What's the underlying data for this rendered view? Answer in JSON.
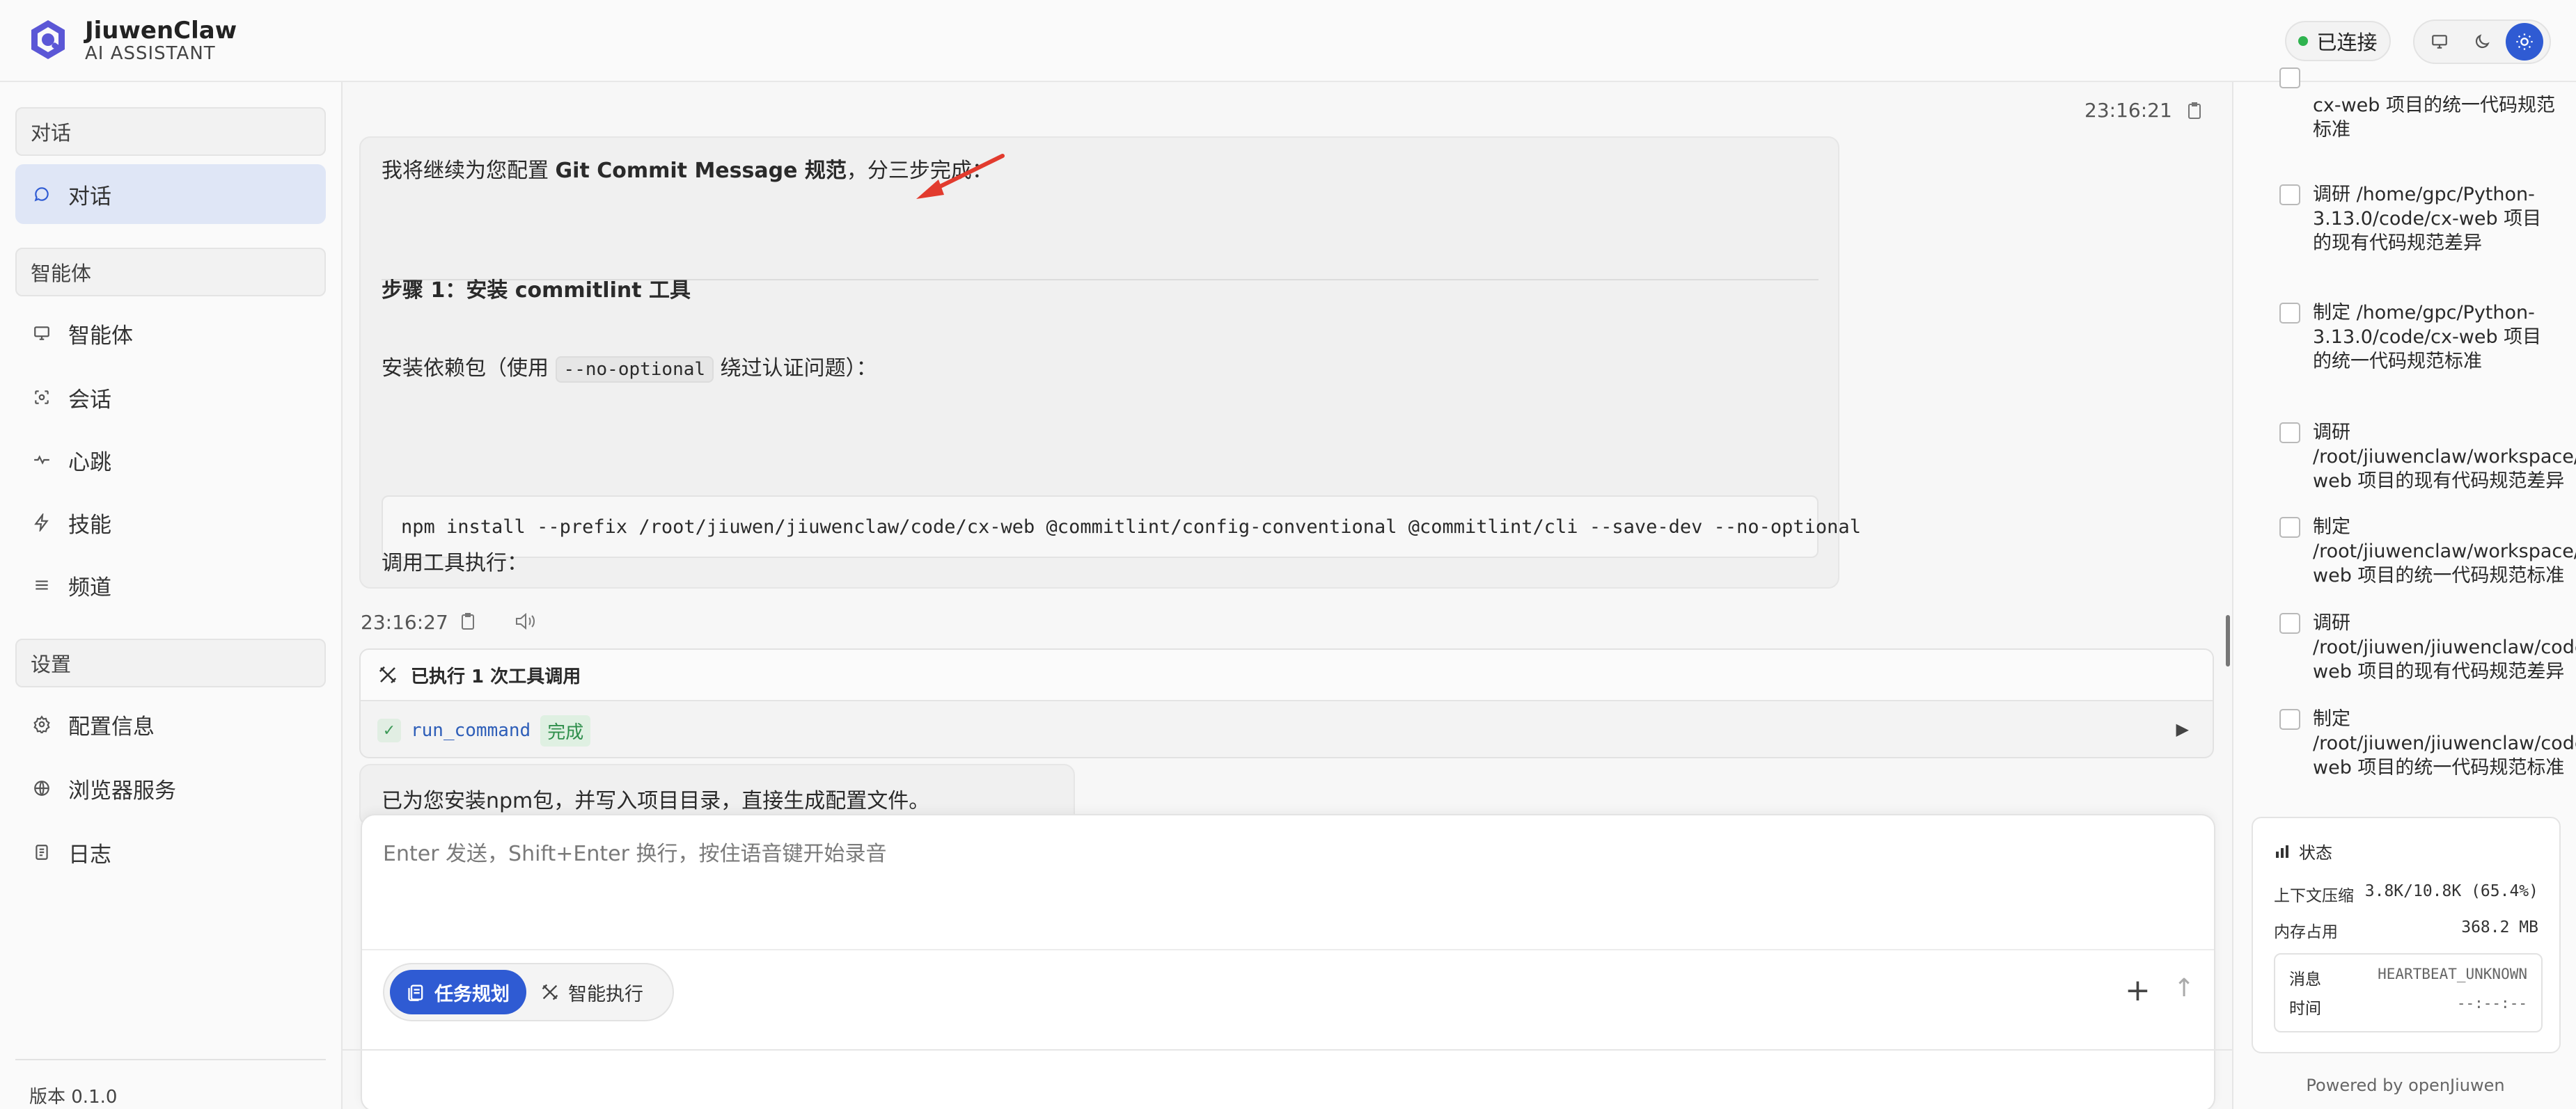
{
  "header": {
    "brand_name": "JiuwenClaw",
    "brand_sub": "AI ASSISTANT",
    "connection_status": "已连接",
    "connection_color": "#2fb34f",
    "theme_buttons": [
      "monitor-icon",
      "moon-icon",
      "sun-icon"
    ],
    "active_theme": "sun-icon",
    "accent": "#2f5bd3"
  },
  "sidebar": {
    "sections": [
      {
        "title": "对话",
        "items": [
          {
            "label": "对话",
            "icon": "chat-bubble-icon",
            "active": true
          }
        ]
      },
      {
        "title": "智能体",
        "items": [
          {
            "label": "智能体",
            "icon": "monitor-icon"
          },
          {
            "label": "会话",
            "icon": "scan-icon"
          },
          {
            "label": "心跳",
            "icon": "pulse-icon"
          },
          {
            "label": "技能",
            "icon": "lightning-icon"
          },
          {
            "label": "频道",
            "icon": "menu-icon"
          }
        ]
      },
      {
        "title": "设置",
        "items": [
          {
            "label": "配置信息",
            "icon": "gear-icon"
          },
          {
            "label": "浏览器服务",
            "icon": "globe-icon"
          },
          {
            "label": "日志",
            "icon": "document-icon"
          }
        ]
      }
    ],
    "version": "版本 0.1.0"
  },
  "chat": {
    "msg1_time": "23:16:21",
    "intro_prefix": "我将继续为您配置 ",
    "intro_bold": "Git Commit Message 规范",
    "intro_suffix": "，分三步完成：",
    "step1_title": "步骤 1：安装 commitlint 工具",
    "install_prefix": "安装依赖包（使用 ",
    "install_code": "--no-optional",
    "install_suffix": " 绕过认证问题）：",
    "code_block": "npm install --prefix /root/jiuwen/jiuwenclaw/code/cx-web @commitlint/config-conventional @commitlint/cli --save-dev --no-optional",
    "tool_call_text": "调用工具执行：",
    "msg2_time": "23:16:27",
    "tool_header": "已执行 1 次工具调用",
    "tool_command": "run_command",
    "tool_status": "完成",
    "msg3_text": "已为您安装npm包，并写入项目目录，直接生成配置文件。"
  },
  "composer": {
    "placeholder": "Enter 发送，Shift+Enter 换行，按住语音键开始录音",
    "mode_active": "任务规划",
    "mode_idle": "智能执行"
  },
  "right_panel": {
    "todos": [
      "cx-web 项目的统一代码规范标准",
      "调研 /home/gpc/Python-3.13.0/code/cx-web 项目的现有代码规范差异",
      "制定 /home/gpc/Python-3.13.0/code/cx-web 项目的统一代码规范标准",
      "调研 /root/jiuwenclaw/workspace/code/cx-web 项目的现有代码规范差异",
      "制定 /root/jiuwenclaw/workspace/code/cx-web 项目的统一代码规范标准",
      "调研 /root/jiuwen/jiuwenclaw/code/cx-web 项目的现有代码规范差异",
      "制定 /root/jiuwen/jiuwenclaw/code/cx-web 项目的统一代码规范标准"
    ],
    "status": {
      "title": "状态",
      "context_label": "上下文压缩",
      "context_value": "3.8K/10.8K (65.4%)",
      "memory_label": "内存占用",
      "memory_value": "368.2 MB",
      "message_label": "消息",
      "message_value": "HEARTBEAT_UNKNOWN",
      "time_label": "时间",
      "time_value": "--:--:--"
    },
    "powered_by": "Powered by openJiuwen"
  }
}
